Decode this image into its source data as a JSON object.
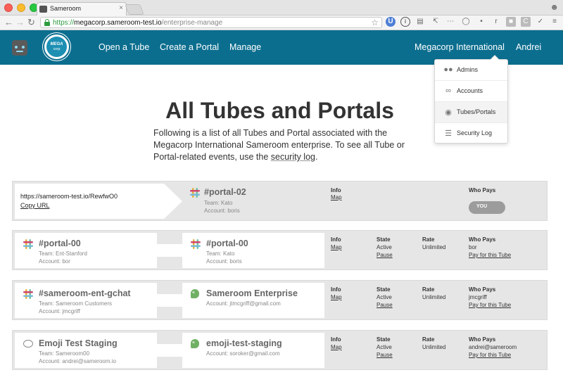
{
  "browser": {
    "tab_title": "Sameroom",
    "tab_close": "×",
    "url_scheme": "https://",
    "url_host": "megacorp.sameroom-test.io",
    "url_path": "/enterprise-manage",
    "ext_labels": [
      "U",
      "i",
      "r",
      "C"
    ]
  },
  "nav": {
    "links": [
      "Open a Tube",
      "Create a Portal",
      "Manage"
    ],
    "org": "Megacorp International",
    "user": "Andrei",
    "logo_text": "MEGA",
    "logo_sub": "corp"
  },
  "dropdown": {
    "items": [
      "Admins",
      "Accounts",
      "Tubes/Portals",
      "Security Log"
    ],
    "active": "Tubes/Portals"
  },
  "hero": {
    "title": "All Tubes and Portals",
    "desc_before": "Following is a list of all Tubes and Portal associated with the Megacorp International Sameroom enterprise. To see all Tube or Portal-related events, use the ",
    "desc_link": "security log",
    "desc_after": "."
  },
  "columns": {
    "info": "Info",
    "state": "State",
    "rate": "Rate",
    "who_pays": "Who Pays",
    "map": "Map",
    "pause": "Pause",
    "pay": "Pay for this Tube"
  },
  "portal_row": {
    "url": "https://sameroom-test.io/RewfwO0",
    "copy": "Copy URL",
    "name": "#portal-02",
    "team": "Team: Kato",
    "account": "Account: boris",
    "toggle": "YOU"
  },
  "tubes": [
    {
      "left_name": "#portal-00",
      "left_team": "Team: Ent-Stanford",
      "left_account": "Account: bor",
      "right_name": "#portal-00",
      "right_team": "Team: Kato",
      "right_account": "Account: boris",
      "state": "Active",
      "rate": "Unlimited",
      "payer": "bor"
    },
    {
      "left_name": "#sameroom-ent-gchat",
      "left_team": "Team: Sameroom Customers",
      "left_account": "Account: jmcgriff",
      "right_name": "Sameroom Enterprise",
      "right_team": "",
      "right_account": "Account: jtmcgriff@gmail.com",
      "state": "Active",
      "rate": "Unlimited",
      "payer": "jmcgriff"
    },
    {
      "left_name": "Emoji Test Staging",
      "left_team": "Team: Sameroom00",
      "left_account": "Account: andrei@sameroom.io",
      "right_name": "emoji-test-staging",
      "right_team": "",
      "right_account": "Account: soroker@gmail.com",
      "state": "Active",
      "rate": "Unlimited",
      "payer": "andrei@sameroom"
    }
  ]
}
